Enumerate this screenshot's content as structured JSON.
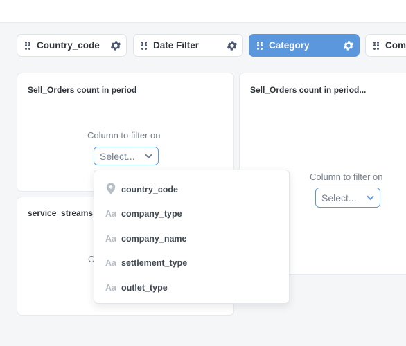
{
  "filters": [
    {
      "label": "Country_code",
      "active": false
    },
    {
      "label": "Date Filter",
      "active": false
    },
    {
      "label": "Category",
      "active": true
    },
    {
      "label": "Comp",
      "active": false
    }
  ],
  "cards": {
    "card1": {
      "title": "Sell_Orders count in period",
      "column_label": "Column to filter on",
      "select_value": "Select..."
    },
    "card2": {
      "title": "Sell_Orders count in period...",
      "column_label": "Column to filter on",
      "select_value": "Select..."
    },
    "card3": {
      "title": "service_streams_",
      "column_label": "C"
    }
  },
  "dropdown": {
    "options": [
      {
        "icon": "location-pin-icon",
        "label": "country_code"
      },
      {
        "icon": "text-field-icon",
        "icon_text": "Aa",
        "label": "company_type"
      },
      {
        "icon": "text-field-icon",
        "icon_text": "Aa",
        "label": "company_name"
      },
      {
        "icon": "text-field-icon",
        "icon_text": "Aa",
        "label": "settlement_type"
      },
      {
        "icon": "text-field-icon",
        "icon_text": "Aa",
        "label": "outlet_type"
      }
    ]
  },
  "colors": {
    "accent": "#5a97dd",
    "background": "#f5f6f8",
    "text": "#2e353b",
    "muted": "#74808c"
  }
}
